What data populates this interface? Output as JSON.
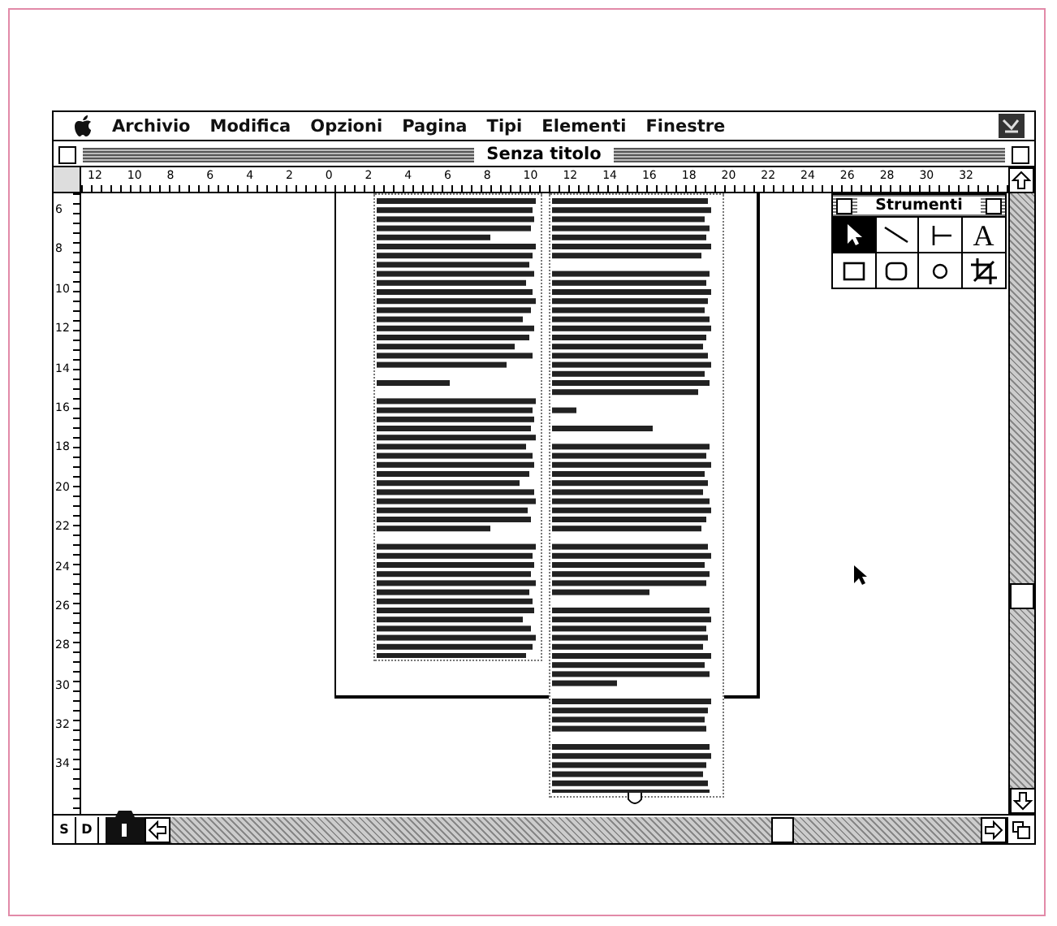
{
  "menu_bar": {
    "items": [
      "Archivio",
      "Modifica",
      "Opzioni",
      "Pagina",
      "Tipi",
      "Elementi",
      "Finestre"
    ]
  },
  "window": {
    "title": "Senza titolo"
  },
  "horizontal_ruler": {
    "labels": [
      "12",
      "10",
      "8",
      "6",
      "4",
      "2",
      "0",
      "2",
      "4",
      "6",
      "8",
      "10",
      "12",
      "14",
      "16",
      "18",
      "20",
      "22",
      "24",
      "26",
      "28",
      "30",
      "32"
    ]
  },
  "vertical_ruler": {
    "labels": [
      "6",
      "8",
      "10",
      "12",
      "14",
      "16",
      "18",
      "20",
      "22",
      "24",
      "26",
      "28",
      "30",
      "32",
      "34"
    ]
  },
  "tool_palette": {
    "title": "Strumenti",
    "tools": [
      {
        "kind": "pointer",
        "selected": true
      },
      {
        "kind": "line",
        "selected": false
      },
      {
        "kind": "perpendicular",
        "selected": false
      },
      {
        "kind": "text",
        "glyph": "A",
        "selected": false
      },
      {
        "kind": "rectangle",
        "selected": false
      },
      {
        "kind": "rounded",
        "selected": false
      },
      {
        "kind": "oval",
        "selected": false
      },
      {
        "kind": "crop",
        "selected": false
      }
    ]
  },
  "page_buttons": [
    {
      "label": "S",
      "selected": false
    },
    {
      "label": "D",
      "selected": false
    }
  ]
}
